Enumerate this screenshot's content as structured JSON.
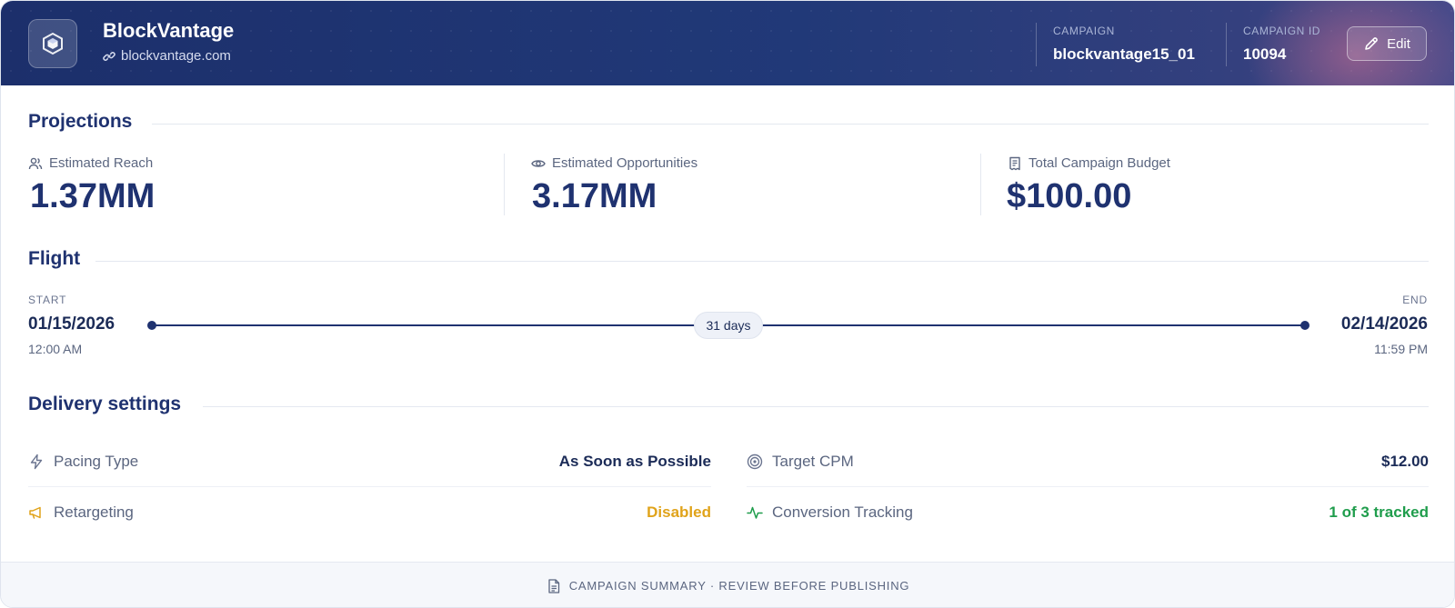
{
  "header": {
    "brand_name": "BlockVantage",
    "brand_url": "blockvantage.com",
    "campaign_label": "CAMPAIGN",
    "campaign_value": "blockvantage15_01",
    "campaign_id_label": "CAMPAIGN ID",
    "campaign_id_value": "10094",
    "edit_label": "Edit"
  },
  "projections": {
    "title": "Projections",
    "metrics": [
      {
        "label": "Estimated Reach",
        "value": "1.37MM",
        "icon": "users-icon"
      },
      {
        "label": "Estimated Opportunities",
        "value": "3.17MM",
        "icon": "eye-icon"
      },
      {
        "label": "Total Campaign Budget",
        "value": "$100.00",
        "icon": "receipt-icon"
      }
    ]
  },
  "flight": {
    "title": "Flight",
    "start_label": "START",
    "start_date": "01/15/2026",
    "start_time": "12:00 AM",
    "end_label": "END",
    "end_date": "02/14/2026",
    "end_time": "11:59 PM",
    "duration": "31 days"
  },
  "delivery": {
    "title": "Delivery settings",
    "settings": [
      {
        "name": "Pacing Type",
        "value": "As Soon as Possible",
        "icon": "lightning-icon",
        "value_color": "#1b2b57"
      },
      {
        "name": "Target CPM",
        "value": "$12.00",
        "icon": "target-icon",
        "value_color": "#1b2b57"
      },
      {
        "name": "Retargeting",
        "value": "Disabled",
        "icon": "megaphone-icon",
        "value_color": "#e0a31a",
        "icon_color": "#e0a31a"
      },
      {
        "name": "Conversion Tracking",
        "value": "1 of 3 tracked",
        "icon": "activity-icon",
        "value_color": "#1f9d4c",
        "icon_color": "#1f9d4c"
      }
    ]
  },
  "footer": {
    "text": "CAMPAIGN SUMMARY · REVIEW BEFORE PUBLISHING"
  },
  "colors": {
    "header_bg": "#1c2f6b",
    "accent": "#1f3270",
    "warning": "#e0a31a",
    "success": "#1f9d4c"
  }
}
